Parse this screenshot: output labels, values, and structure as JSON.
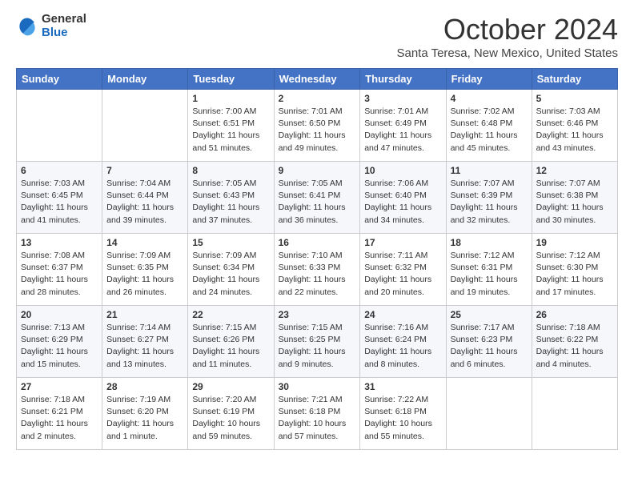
{
  "logo": {
    "general": "General",
    "blue": "Blue"
  },
  "header": {
    "month": "October 2024",
    "location": "Santa Teresa, New Mexico, United States"
  },
  "days_of_week": [
    "Sunday",
    "Monday",
    "Tuesday",
    "Wednesday",
    "Thursday",
    "Friday",
    "Saturday"
  ],
  "weeks": [
    [
      {
        "day": "",
        "info": ""
      },
      {
        "day": "",
        "info": ""
      },
      {
        "day": "1",
        "info": "Sunrise: 7:00 AM\nSunset: 6:51 PM\nDaylight: 11 hours and 51 minutes."
      },
      {
        "day": "2",
        "info": "Sunrise: 7:01 AM\nSunset: 6:50 PM\nDaylight: 11 hours and 49 minutes."
      },
      {
        "day": "3",
        "info": "Sunrise: 7:01 AM\nSunset: 6:49 PM\nDaylight: 11 hours and 47 minutes."
      },
      {
        "day": "4",
        "info": "Sunrise: 7:02 AM\nSunset: 6:48 PM\nDaylight: 11 hours and 45 minutes."
      },
      {
        "day": "5",
        "info": "Sunrise: 7:03 AM\nSunset: 6:46 PM\nDaylight: 11 hours and 43 minutes."
      }
    ],
    [
      {
        "day": "6",
        "info": "Sunrise: 7:03 AM\nSunset: 6:45 PM\nDaylight: 11 hours and 41 minutes."
      },
      {
        "day": "7",
        "info": "Sunrise: 7:04 AM\nSunset: 6:44 PM\nDaylight: 11 hours and 39 minutes."
      },
      {
        "day": "8",
        "info": "Sunrise: 7:05 AM\nSunset: 6:43 PM\nDaylight: 11 hours and 37 minutes."
      },
      {
        "day": "9",
        "info": "Sunrise: 7:05 AM\nSunset: 6:41 PM\nDaylight: 11 hours and 36 minutes."
      },
      {
        "day": "10",
        "info": "Sunrise: 7:06 AM\nSunset: 6:40 PM\nDaylight: 11 hours and 34 minutes."
      },
      {
        "day": "11",
        "info": "Sunrise: 7:07 AM\nSunset: 6:39 PM\nDaylight: 11 hours and 32 minutes."
      },
      {
        "day": "12",
        "info": "Sunrise: 7:07 AM\nSunset: 6:38 PM\nDaylight: 11 hours and 30 minutes."
      }
    ],
    [
      {
        "day": "13",
        "info": "Sunrise: 7:08 AM\nSunset: 6:37 PM\nDaylight: 11 hours and 28 minutes."
      },
      {
        "day": "14",
        "info": "Sunrise: 7:09 AM\nSunset: 6:35 PM\nDaylight: 11 hours and 26 minutes."
      },
      {
        "day": "15",
        "info": "Sunrise: 7:09 AM\nSunset: 6:34 PM\nDaylight: 11 hours and 24 minutes."
      },
      {
        "day": "16",
        "info": "Sunrise: 7:10 AM\nSunset: 6:33 PM\nDaylight: 11 hours and 22 minutes."
      },
      {
        "day": "17",
        "info": "Sunrise: 7:11 AM\nSunset: 6:32 PM\nDaylight: 11 hours and 20 minutes."
      },
      {
        "day": "18",
        "info": "Sunrise: 7:12 AM\nSunset: 6:31 PM\nDaylight: 11 hours and 19 minutes."
      },
      {
        "day": "19",
        "info": "Sunrise: 7:12 AM\nSunset: 6:30 PM\nDaylight: 11 hours and 17 minutes."
      }
    ],
    [
      {
        "day": "20",
        "info": "Sunrise: 7:13 AM\nSunset: 6:29 PM\nDaylight: 11 hours and 15 minutes."
      },
      {
        "day": "21",
        "info": "Sunrise: 7:14 AM\nSunset: 6:27 PM\nDaylight: 11 hours and 13 minutes."
      },
      {
        "day": "22",
        "info": "Sunrise: 7:15 AM\nSunset: 6:26 PM\nDaylight: 11 hours and 11 minutes."
      },
      {
        "day": "23",
        "info": "Sunrise: 7:15 AM\nSunset: 6:25 PM\nDaylight: 11 hours and 9 minutes."
      },
      {
        "day": "24",
        "info": "Sunrise: 7:16 AM\nSunset: 6:24 PM\nDaylight: 11 hours and 8 minutes."
      },
      {
        "day": "25",
        "info": "Sunrise: 7:17 AM\nSunset: 6:23 PM\nDaylight: 11 hours and 6 minutes."
      },
      {
        "day": "26",
        "info": "Sunrise: 7:18 AM\nSunset: 6:22 PM\nDaylight: 11 hours and 4 minutes."
      }
    ],
    [
      {
        "day": "27",
        "info": "Sunrise: 7:18 AM\nSunset: 6:21 PM\nDaylight: 11 hours and 2 minutes."
      },
      {
        "day": "28",
        "info": "Sunrise: 7:19 AM\nSunset: 6:20 PM\nDaylight: 11 hours and 1 minute."
      },
      {
        "day": "29",
        "info": "Sunrise: 7:20 AM\nSunset: 6:19 PM\nDaylight: 10 hours and 59 minutes."
      },
      {
        "day": "30",
        "info": "Sunrise: 7:21 AM\nSunset: 6:18 PM\nDaylight: 10 hours and 57 minutes."
      },
      {
        "day": "31",
        "info": "Sunrise: 7:22 AM\nSunset: 6:18 PM\nDaylight: 10 hours and 55 minutes."
      },
      {
        "day": "",
        "info": ""
      },
      {
        "day": "",
        "info": ""
      }
    ]
  ]
}
